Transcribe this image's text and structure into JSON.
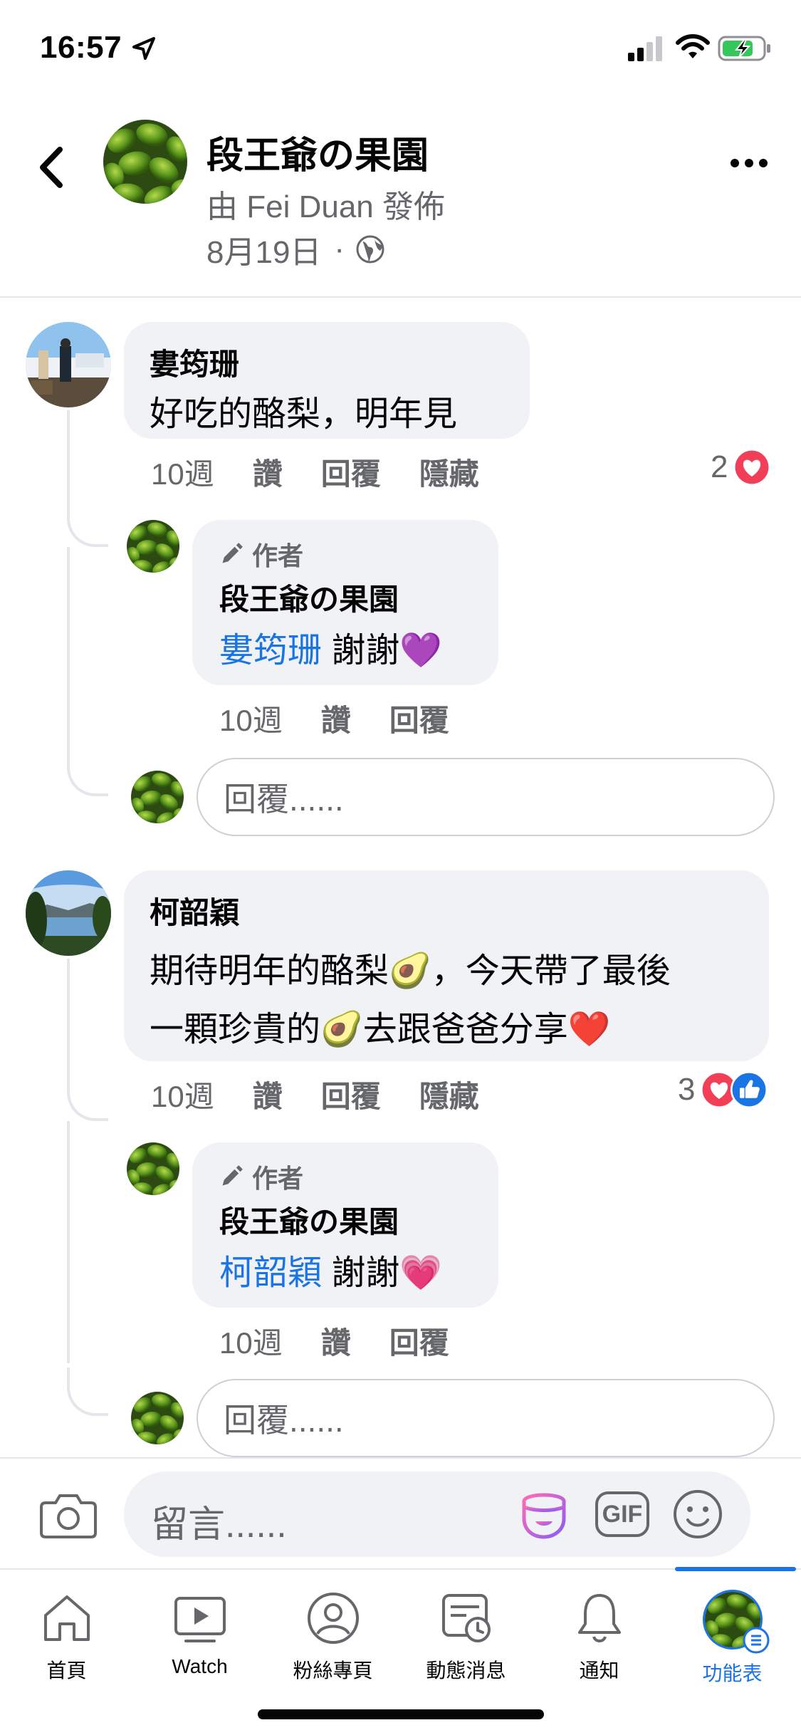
{
  "status_bar": {
    "time": "16:57"
  },
  "header": {
    "page_name": "段王爺の果園",
    "posted_by": "由 Fei Duan 發佈",
    "date": "8月19日",
    "separator": "·"
  },
  "comments": [
    {
      "name": "婁筠珊",
      "text": "好吃的酪梨，明年見",
      "time": "10週",
      "like": "讚",
      "reply": "回覆",
      "hide": "隱藏",
      "reaction_count": "2",
      "author_reply": {
        "badge": "作者",
        "name": "段王爺の果園",
        "mention": "婁筠珊",
        "text": " 謝謝💜",
        "time": "10週",
        "like": "讚",
        "reply": "回覆"
      },
      "reply_placeholder": "回覆......"
    },
    {
      "name": "柯韶穎",
      "text_line1": "期待明年的酪梨🥑，今天帶了最後",
      "text_line2": "一顆珍貴的🥑去跟爸爸分享❤️",
      "time": "10週",
      "like": "讚",
      "reply": "回覆",
      "hide": "隱藏",
      "reaction_count": "3",
      "author_reply": {
        "badge": "作者",
        "name": "段王爺の果園",
        "mention": "柯韶穎",
        "text": " 謝謝💗",
        "time": "10週",
        "like": "讚",
        "reply": "回覆"
      },
      "reply_placeholder": "回覆......"
    }
  ],
  "composer": {
    "placeholder": "留言......",
    "gif_label": "GIF"
  },
  "tabs": [
    {
      "label": "首頁",
      "icon": "home-icon"
    },
    {
      "label": "Watch",
      "icon": "watch-icon"
    },
    {
      "label": "粉絲專頁",
      "icon": "pages-icon"
    },
    {
      "label": "動態消息",
      "icon": "feeds-icon"
    },
    {
      "label": "通知",
      "icon": "bell-icon"
    },
    {
      "label": "功能表",
      "icon": "menu-icon"
    }
  ],
  "colors": {
    "accent": "#1b74e4",
    "bubble": "#f0f2f5",
    "secondary_text": "#65676b",
    "love": "#f33e58"
  }
}
